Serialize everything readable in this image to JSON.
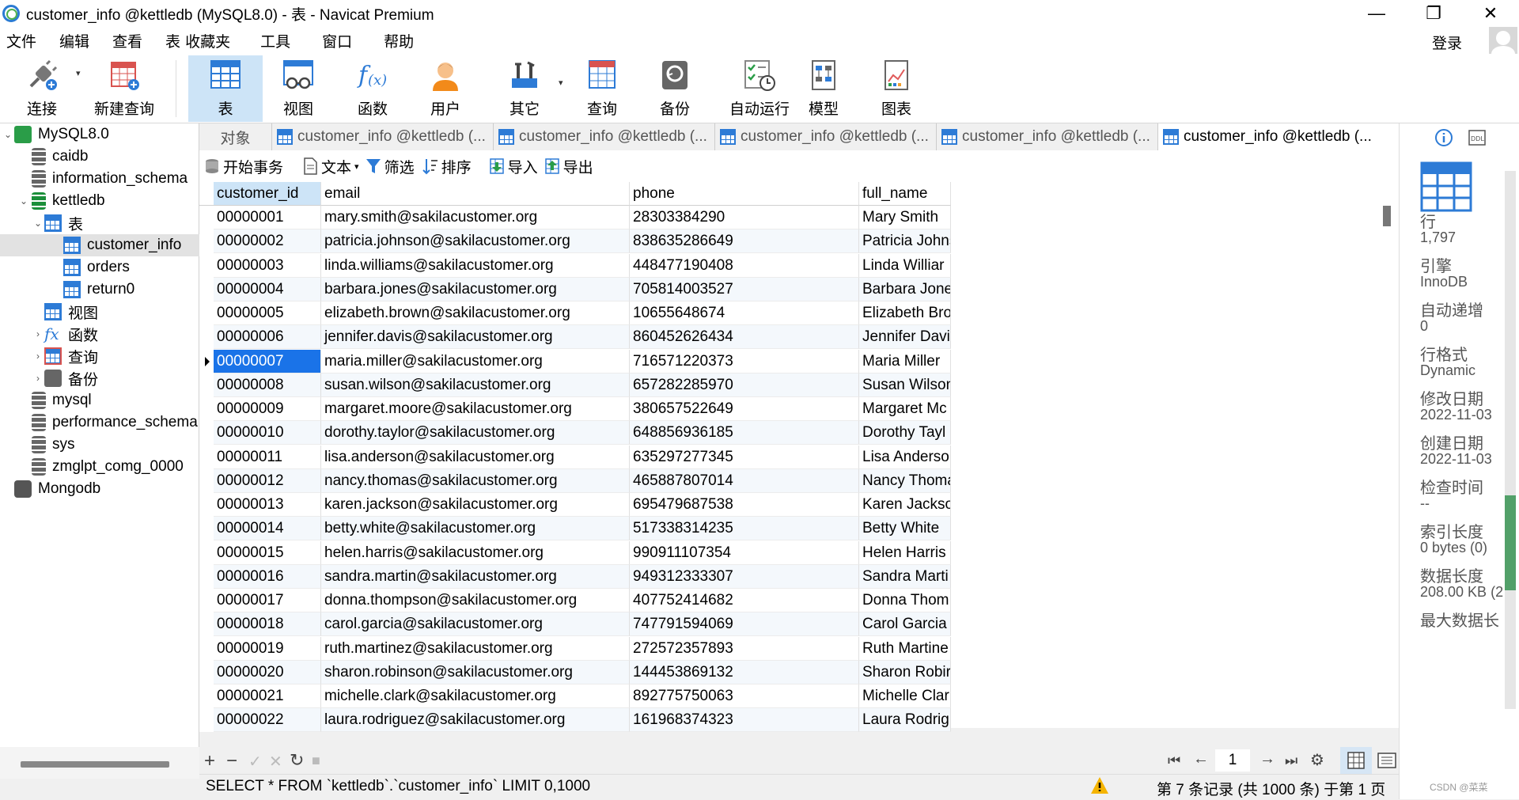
{
  "window": {
    "title": "customer_info @kettledb (MySQL8.0) - 表 - Navicat Premium"
  },
  "menu": [
    "文件",
    "编辑",
    "查看",
    "表",
    "收藏夹",
    "工具",
    "窗口",
    "帮助"
  ],
  "account": {
    "login": "登录"
  },
  "toolbar": {
    "connect": "连接",
    "new_query": "新建查询",
    "table": "表",
    "view": "视图",
    "function": "函数",
    "user": "用户",
    "other": "其它",
    "query": "查询",
    "backup": "备份",
    "automation": "自动运行",
    "model": "模型",
    "chart": "图表"
  },
  "tree": {
    "mysql": "MySQL8.0",
    "caidb": "caidb",
    "information_schema": "information_schema",
    "kettledb": "kettledb",
    "tables": "表",
    "customer_info": "customer_info",
    "orders": "orders",
    "return0": "return0",
    "views": "视图",
    "functions": "函数",
    "queries": "查询",
    "backups": "备份",
    "mysqldb": "mysql",
    "performance_schema": "performance_schema",
    "sys": "sys",
    "zmglpt": "zmglpt_comg_0000",
    "mongodb": "Mongodb"
  },
  "tabs": {
    "objects": "对象",
    "t1": "customer_info @kettledb (...",
    "t2": "customer_info @kettledb (...",
    "t3": "customer_info @kettledb (...",
    "t4": "customer_info @kettledb (...",
    "t5": "customer_info @kettledb (..."
  },
  "gridtoolbar": {
    "begin_tx": "开始事务",
    "text": "文本",
    "filter": "筛选",
    "sort": "排序",
    "import": "导入",
    "export": "导出"
  },
  "columns": [
    "customer_id",
    "email",
    "phone",
    "full_name"
  ],
  "rows": [
    [
      "00000001",
      "mary.smith@sakilacustomer.org",
      "28303384290",
      "Mary Smith"
    ],
    [
      "00000002",
      "patricia.johnson@sakilacustomer.org",
      "838635286649",
      "Patricia Johns"
    ],
    [
      "00000003",
      "linda.williams@sakilacustomer.org",
      "448477190408",
      "Linda Williar"
    ],
    [
      "00000004",
      "barbara.jones@sakilacustomer.org",
      "705814003527",
      "Barbara Jone"
    ],
    [
      "00000005",
      "elizabeth.brown@sakilacustomer.org",
      "10655648674",
      "Elizabeth Bro"
    ],
    [
      "00000006",
      "jennifer.davis@sakilacustomer.org",
      "860452626434",
      "Jennifer Davi"
    ],
    [
      "00000007",
      "maria.miller@sakilacustomer.org",
      "716571220373",
      "Maria Miller"
    ],
    [
      "00000008",
      "susan.wilson@sakilacustomer.org",
      "657282285970",
      "Susan Wilson"
    ],
    [
      "00000009",
      "margaret.moore@sakilacustomer.org",
      "380657522649",
      "Margaret Mc"
    ],
    [
      "00000010",
      "dorothy.taylor@sakilacustomer.org",
      "648856936185",
      "Dorothy Tayl"
    ],
    [
      "00000011",
      "lisa.anderson@sakilacustomer.org",
      "635297277345",
      "Lisa Andersoi"
    ],
    [
      "00000012",
      "nancy.thomas@sakilacustomer.org",
      "465887807014",
      "Nancy Thoma"
    ],
    [
      "00000013",
      "karen.jackson@sakilacustomer.org",
      "695479687538",
      "Karen Jackso"
    ],
    [
      "00000014",
      "betty.white@sakilacustomer.org",
      "517338314235",
      "Betty White"
    ],
    [
      "00000015",
      "helen.harris@sakilacustomer.org",
      "990911107354",
      "Helen Harris"
    ],
    [
      "00000016",
      "sandra.martin@sakilacustomer.org",
      "949312333307",
      "Sandra Marti"
    ],
    [
      "00000017",
      "donna.thompson@sakilacustomer.org",
      "407752414682",
      "Donna Thom"
    ],
    [
      "00000018",
      "carol.garcia@sakilacustomer.org",
      "747791594069",
      "Carol Garcia"
    ],
    [
      "00000019",
      "ruth.martinez@sakilacustomer.org",
      "272572357893",
      "Ruth Martine"
    ],
    [
      "00000020",
      "sharon.robinson@sakilacustomer.org",
      "144453869132",
      "Sharon Robir"
    ],
    [
      "00000021",
      "michelle.clark@sakilacustomer.org",
      "892775750063",
      "Michelle Clar"
    ],
    [
      "00000022",
      "laura.rodriguez@sakilacustomer.org",
      "161968374323",
      "Laura Rodrig"
    ]
  ],
  "selected_row_index": 6,
  "pager": {
    "page": "1"
  },
  "status": {
    "sql": "SELECT * FROM `kettledb`.`customer_info` LIMIT 0,1000",
    "record": "第 7 条记录 (共 1000 条) 于第 1 页"
  },
  "info": {
    "rows_label": "行",
    "rows_value": "1,797",
    "engine_label": "引擎",
    "engine_value": "InnoDB",
    "autoinc_label": "自动递增",
    "autoinc_value": "0",
    "rowformat_label": "行格式",
    "rowformat_value": "Dynamic",
    "modified_label": "修改日期",
    "modified_value": "2022-11-03",
    "created_label": "创建日期",
    "created_value": "2022-11-03",
    "checktime_label": "检查时间",
    "checktime_value": "--",
    "indexlen_label": "索引长度",
    "indexlen_value": "0 bytes (0)",
    "datalen_label": "数据长度",
    "datalen_value": "208.00 KB (2",
    "maxdata_label": "最大数据长"
  },
  "watermark": "CSDN @菜菜",
  "colors": {
    "selection": "#1a73e8",
    "accent": "#2d7bd6",
    "active_tool": "#cde4f7"
  }
}
